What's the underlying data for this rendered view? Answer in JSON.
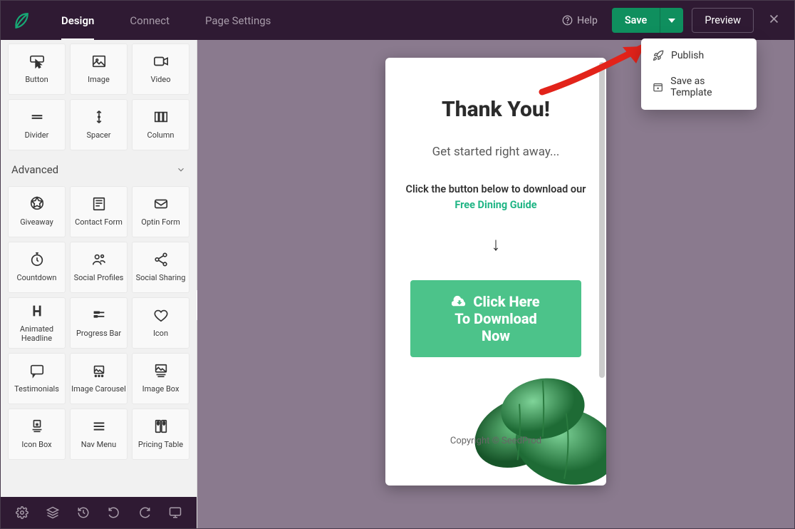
{
  "nav": {
    "design": "Design",
    "connect": "Connect",
    "page_settings": "Page Settings"
  },
  "header": {
    "help": "Help",
    "save": "Save",
    "preview": "Preview"
  },
  "dropdown": {
    "publish": "Publish",
    "save_template": "Save as Template"
  },
  "sidebar": {
    "section_advanced": "Advanced",
    "blocks_basic": [
      {
        "id": "button",
        "label": "Button"
      },
      {
        "id": "image",
        "label": "Image"
      },
      {
        "id": "video",
        "label": "Video"
      },
      {
        "id": "divider",
        "label": "Divider"
      },
      {
        "id": "spacer",
        "label": "Spacer"
      },
      {
        "id": "column",
        "label": "Column"
      }
    ],
    "blocks_advanced": [
      {
        "id": "giveaway",
        "label": "Giveaway"
      },
      {
        "id": "contact-form",
        "label": "Contact Form"
      },
      {
        "id": "optin-form",
        "label": "Optin Form"
      },
      {
        "id": "countdown",
        "label": "Countdown"
      },
      {
        "id": "social-profiles",
        "label": "Social Profiles"
      },
      {
        "id": "social-sharing",
        "label": "Social Sharing"
      },
      {
        "id": "animated-headline",
        "label": "Animated\nHeadline"
      },
      {
        "id": "progress-bar",
        "label": "Progress Bar"
      },
      {
        "id": "icon",
        "label": "Icon"
      },
      {
        "id": "testimonials",
        "label": "Testimonials"
      },
      {
        "id": "image-carousel",
        "label": "Image Carousel"
      },
      {
        "id": "image-box",
        "label": "Image Box"
      },
      {
        "id": "icon-box",
        "label": "Icon Box"
      },
      {
        "id": "nav-menu",
        "label": "Nav Menu"
      },
      {
        "id": "pricing-table",
        "label": "Pricing Table"
      }
    ]
  },
  "canvas": {
    "title": "Thank You!",
    "subtitle": "Get started right away...",
    "desc_line1": "Click the button below to download our",
    "guide_text": "Free Dining Guide",
    "arrow": "↓",
    "cta_line1": "Click Here",
    "cta_line2": "To Download",
    "cta_line3": "Now",
    "copyright": "Copyright © SeedProd"
  }
}
